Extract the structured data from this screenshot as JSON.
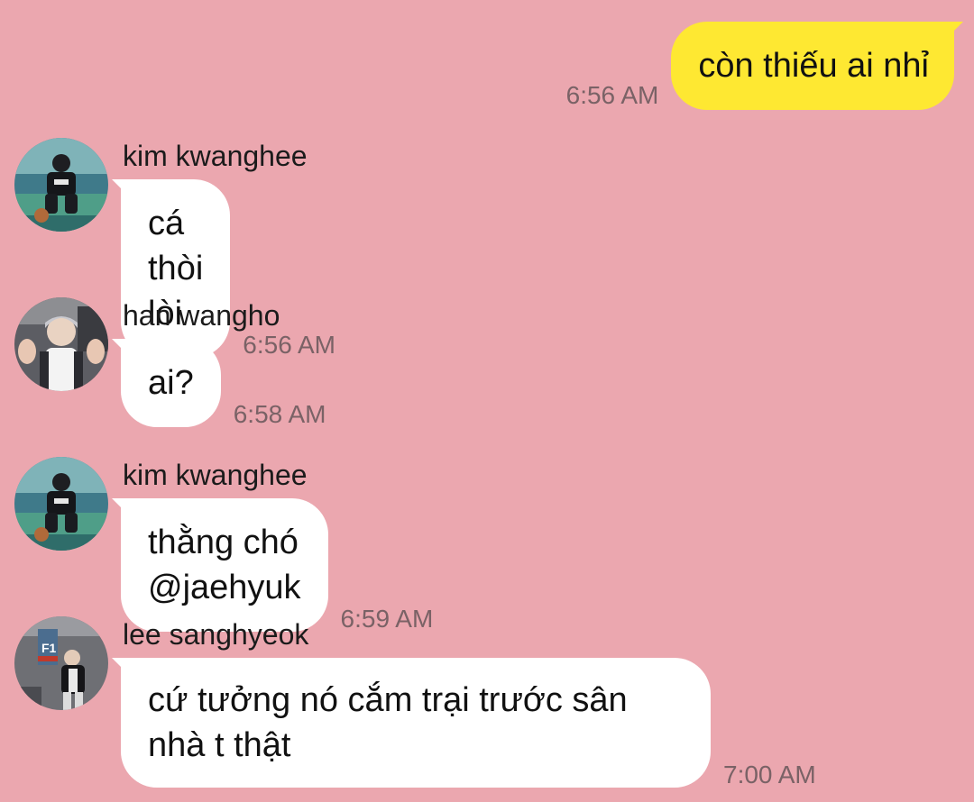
{
  "outgoing": {
    "text": "còn thiếu ai nhỉ",
    "time": "6:56 AM",
    "bubble_color": "#FEE832"
  },
  "messages": [
    {
      "sender": "kim kwanghee",
      "text": "cá thòi lòi",
      "time": "6:56 AM",
      "avatar": "avatar-kim-kwanghee"
    },
    {
      "sender": "han wangho",
      "text": "ai?",
      "time": "6:58 AM",
      "avatar": "avatar-han-wangho"
    },
    {
      "sender": "kim kwanghee",
      "text": "thằng chó @jaehyuk",
      "time": "6:59 AM",
      "avatar": "avatar-kim-kwanghee"
    },
    {
      "sender": "lee sanghyeok",
      "text_line1": "cứ tưởng nó cắm trại trước sân",
      "text_line2": "nhà t thật",
      "time": "7:00 AM",
      "avatar": "avatar-lee-sanghyeok",
      "avatar_sign": "F1"
    }
  ],
  "colors": {
    "background": "#EBA7AF",
    "incoming_bubble": "#FFFFFF",
    "timestamp": "#7A6266"
  }
}
